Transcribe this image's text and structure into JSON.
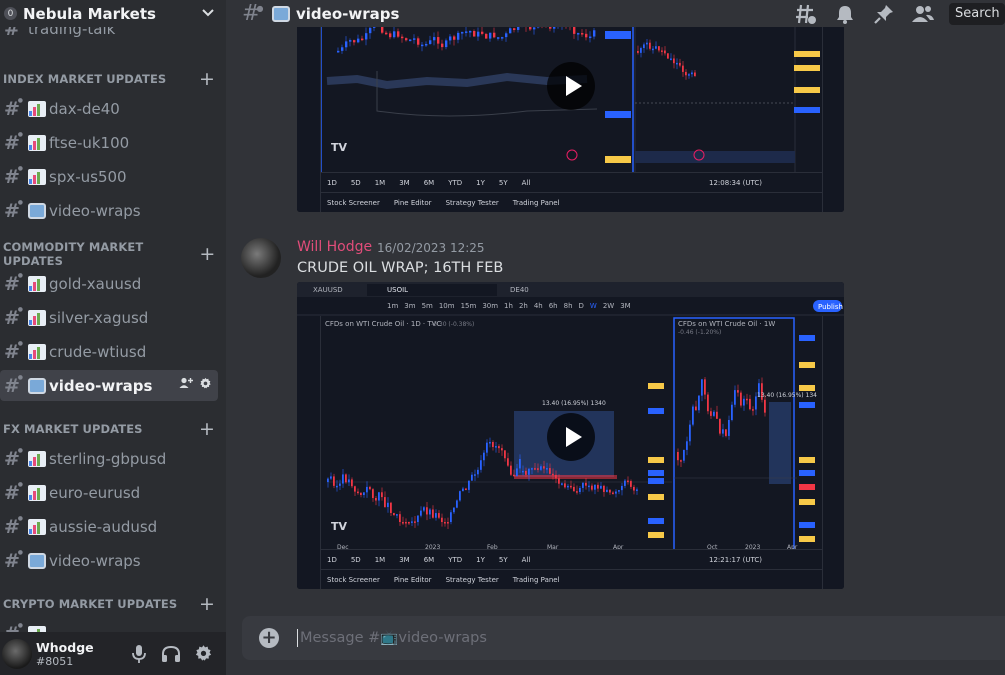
{
  "server": {
    "name": "Nebula Markets",
    "badge": "0"
  },
  "channel_header": {
    "title": "video-wraps",
    "search_label": "Search"
  },
  "sidebar": {
    "partial_channel": "trading-talk",
    "categories": [
      {
        "label": "INDEX MARKET UPDATES",
        "channels": [
          "dax-de40",
          "ftse-uk100",
          "spx-us500",
          "video-wraps"
        ]
      },
      {
        "label": "COMMODITY MARKET UPDATES",
        "channels": [
          "gold-xauusd",
          "silver-xagusd",
          "crude-wtiusd",
          "video-wraps"
        ]
      },
      {
        "label": "FX MARKET UPDATES",
        "channels": [
          "sterling-gbpusd",
          "euro-eurusd",
          "aussie-audusd",
          "video-wraps"
        ]
      },
      {
        "label": "CRYPTO MARKET UPDATES",
        "channels": []
      }
    ],
    "active_channel": "video-wraps"
  },
  "user": {
    "name": "Whodge",
    "tag": "#8051"
  },
  "message": {
    "author": "Will Hodge",
    "timestamp": "16/02/2023 12:25",
    "text": "CRUDE OIL WRAP; 16TH FEB",
    "author_color": "#e14d7a"
  },
  "embed1": {
    "timeframes": [
      "1D",
      "5D",
      "1M",
      "3M",
      "6M",
      "YTD",
      "1Y",
      "5Y",
      "All"
    ],
    "bottom_tabs": [
      "Stock Screener",
      "Pine Editor",
      "Strategy Tester",
      "Trading Panel"
    ],
    "clock": "12:08:34 (UTC)"
  },
  "embed2": {
    "tabs": [
      "XAUUSD",
      "USOIL",
      "DE40"
    ],
    "toolbar": [
      "1m",
      "3m",
      "5m",
      "10m",
      "15m",
      "30m",
      "1h",
      "2h",
      "4h",
      "6h",
      "8h",
      "D",
      "W",
      "2W",
      "3M"
    ],
    "publish_label": "Publish",
    "left_title": "CFDs on WTI Crude Oil · 1D · TVC",
    "right_title": "CFDs on WTI Crude Oil · 1W",
    "left_change": "-0.30 (-0.38%)",
    "right_change": "-0.46 (-1.20%)",
    "measure_left": "13.40 (16.95%) 1340",
    "measure_right": "13.40 (16.95%) 134",
    "left_axis_months": [
      "Dec",
      "2023",
      "Feb",
      "Mar",
      "Apr"
    ],
    "right_axis_months": [
      "Oct",
      "2023",
      "Apr"
    ],
    "timeframes": [
      "1D",
      "5D",
      "1M",
      "3M",
      "6M",
      "YTD",
      "1Y",
      "5Y",
      "All"
    ],
    "bottom_tabs": [
      "Stock Screener",
      "Pine Editor",
      "Strategy Tester",
      "Trading Panel"
    ],
    "clock": "12:21:17 (UTC)"
  },
  "composer": {
    "placeholder": "Message #📺video-wraps"
  },
  "colors": {
    "bull": "#2962ff",
    "bear": "#f23645",
    "highlight": "#2f4d8a"
  }
}
